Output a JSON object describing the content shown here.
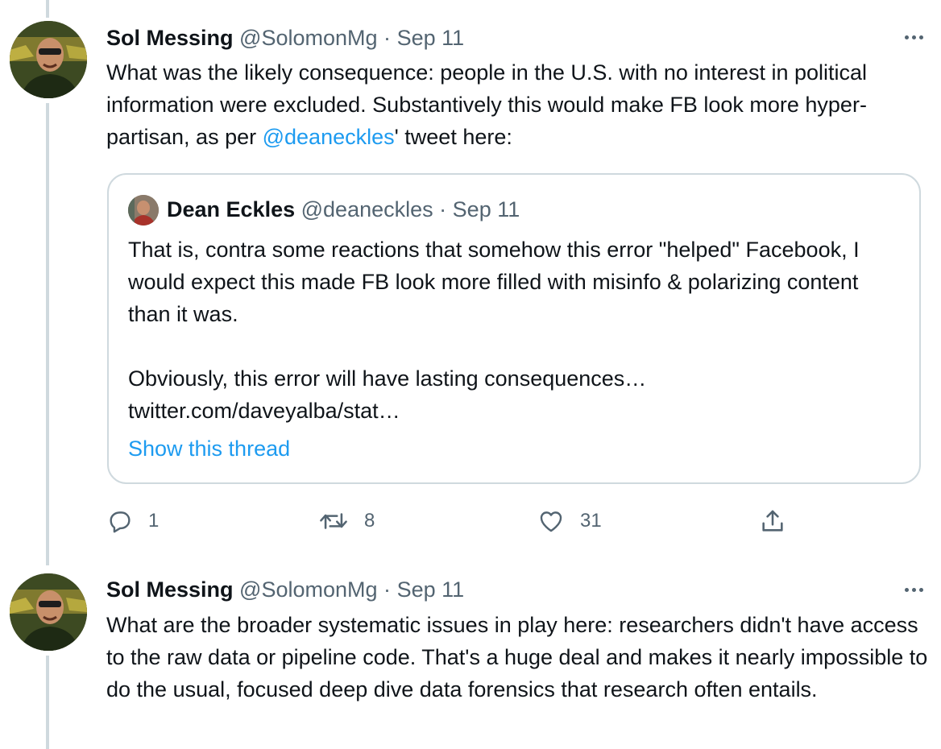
{
  "tweets": [
    {
      "author": "Sol Messing",
      "handle": "@SolomonMg",
      "separator": "·",
      "date": "Sep 11",
      "text_before": "What was the likely consequence: people in the U.S. with no interest in political information were excluded. Substantively this would make FB look more hyper-partisan, as per ",
      "mention": "@deaneckles",
      "text_after": "' tweet here:",
      "quote": {
        "author": "Dean Eckles",
        "handle": "@deaneckles",
        "separator": "·",
        "date": "Sep 11",
        "paragraph1": "That is, contra some reactions that somehow this error \"helped\" Facebook, I would expect this made FB look more filled with misinfo & polarizing content than it was.",
        "paragraph2_line1": "Obviously, this error will have lasting consequences…",
        "paragraph2_line2": "twitter.com/daveyalba/stat…",
        "show_thread": "Show this thread"
      },
      "actions": {
        "replies": "1",
        "retweets": "8",
        "likes": "31"
      }
    },
    {
      "author": "Sol Messing",
      "handle": "@SolomonMg",
      "separator": "·",
      "date": "Sep 11",
      "text": "What are the broader systematic issues in play here: researchers didn't have access to the raw data or pipeline code. That's a huge deal and makes it nearly impossible to do the usual, focused deep dive data forensics that research often entails."
    }
  ],
  "icons": {
    "reply": "reply-icon",
    "retweet": "retweet-icon",
    "like": "heart-icon",
    "share": "share-icon",
    "more": "more-icon"
  },
  "colors": {
    "link": "#1d9bf0",
    "muted": "#536471",
    "border": "#cfd9de",
    "text": "#0f1419"
  }
}
